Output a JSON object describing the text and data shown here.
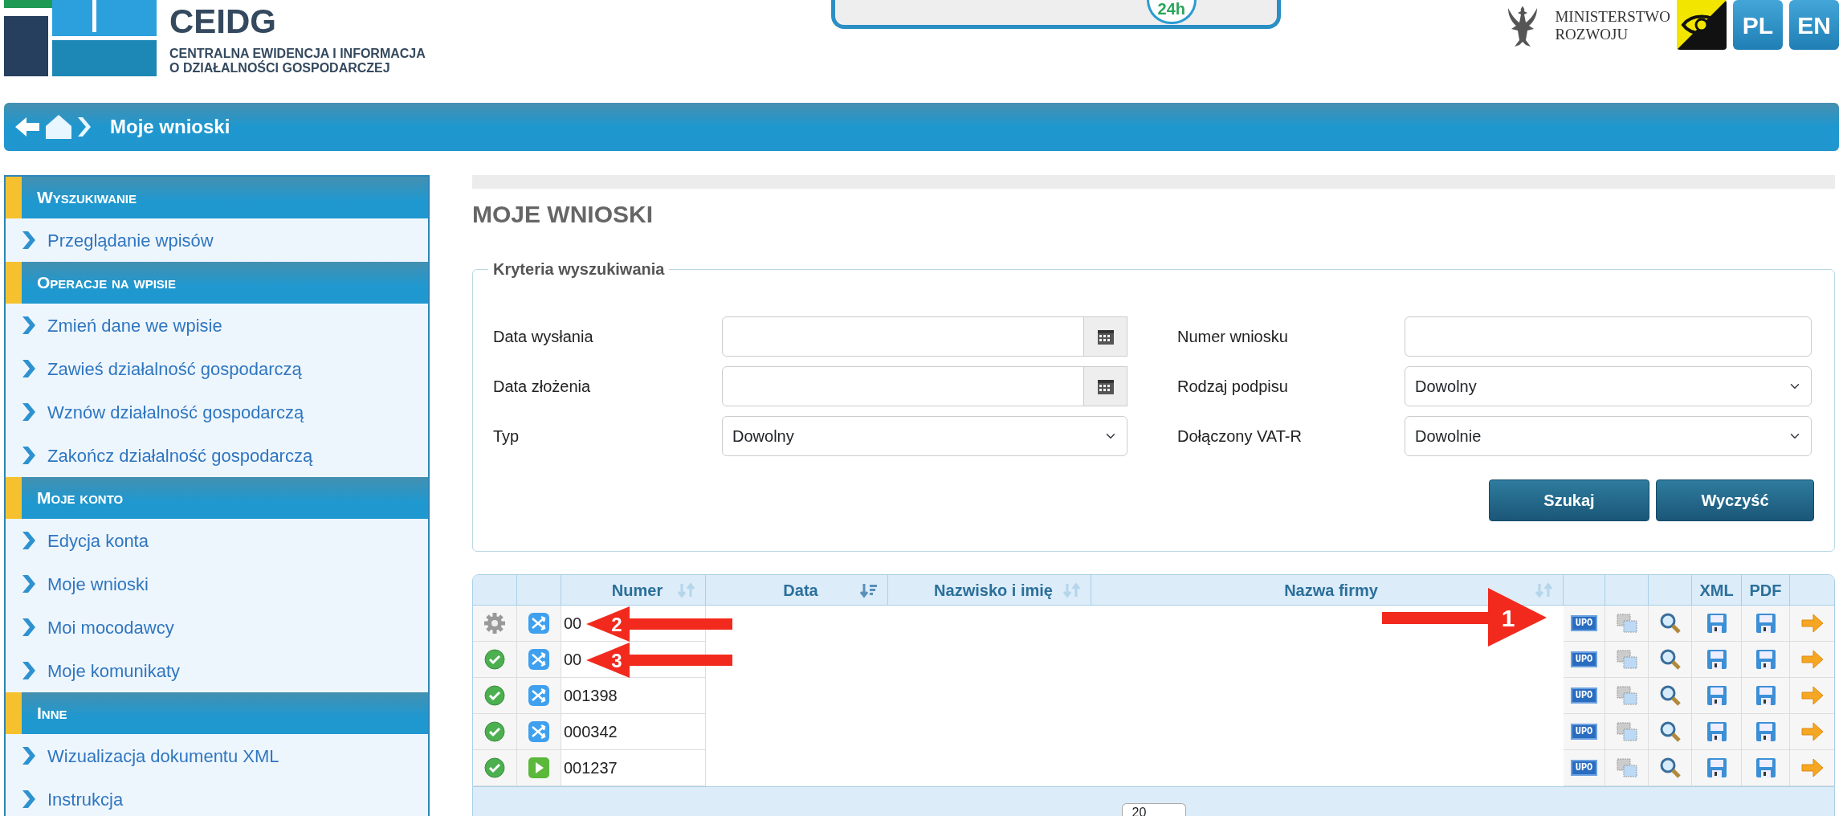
{
  "header": {
    "title": "CEIDG",
    "subtitle_lines": [
      "CENTRALNA EWIDENCJA I INFORMACJA",
      "O DZIAŁALNOŚCI GOSPODARCZEJ"
    ],
    "banner_badge": "24h",
    "ministry_lines": [
      "MINISTERSTWO",
      "ROZWOJU"
    ],
    "languages": [
      "PL",
      "EN"
    ]
  },
  "breadcrumb": {
    "title": "Moje wnioski"
  },
  "sidebar": {
    "sections": [
      {
        "title": "Wyszukiwanie",
        "items": [
          "Przeglądanie wpisów"
        ]
      },
      {
        "title": "Operacje na wpisie",
        "items": [
          "Zmień dane we wpisie",
          "Zawieś działalność gospodarczą",
          "Wznów działalność gospodarczą",
          "Zakończ działalność gospodarczą"
        ]
      },
      {
        "title": "Moje konto",
        "items": [
          "Edycja konta",
          "Moje wnioski",
          "Moi mocodawcy",
          "Moje komunikaty"
        ]
      },
      {
        "title": "Inne",
        "items": [
          "Wizualizacja dokumentu XML",
          "Instrukcja"
        ]
      }
    ]
  },
  "page_title": "MOJE WNIOSKI",
  "search": {
    "legend": "Kryteria wyszukiwania",
    "fields": [
      {
        "kind": "date",
        "label": "Data wysłania"
      },
      {
        "kind": "text",
        "label": "Numer wniosku"
      },
      {
        "kind": "date",
        "label": "Data złożenia"
      },
      {
        "kind": "select",
        "label": "Rodzaj podpisu",
        "value": "Dowolny"
      },
      {
        "kind": "select",
        "label": "Typ",
        "value": "Dowolny"
      },
      {
        "kind": "select",
        "label": "Dołączony VAT-R",
        "value": "Dowolnie"
      }
    ],
    "buttons": [
      "Szukaj",
      "Wyczyść"
    ]
  },
  "table": {
    "columns": [
      {
        "kind": "blank"
      },
      {
        "kind": "blank"
      },
      {
        "kind": "sortable",
        "label": "Numer",
        "sorted_desc": false
      },
      {
        "kind": "sortable",
        "label": "Data",
        "sorted_desc": true
      },
      {
        "kind": "sortable",
        "label": "Nazwisko i imię",
        "sorted_desc": false
      },
      {
        "kind": "sortable",
        "label": "Nazwa firmy",
        "sorted_desc": false
      },
      {
        "kind": "blank"
      },
      {
        "kind": "blank"
      },
      {
        "kind": "blank"
      },
      {
        "kind": "label",
        "label": "XML"
      },
      {
        "kind": "label",
        "label": "PDF"
      },
      {
        "kind": "blank"
      }
    ],
    "rows": [
      {
        "processing": true,
        "kind": "transfer",
        "number": "00",
        "upo": "UPO"
      },
      {
        "processing": false,
        "kind": "transfer",
        "number": "00",
        "upo": "UPO"
      },
      {
        "processing": false,
        "kind": "transfer",
        "number": "001398",
        "upo": "UPO"
      },
      {
        "processing": false,
        "kind": "transfer",
        "number": "000342",
        "upo": "UPO"
      },
      {
        "processing": false,
        "kind": "play",
        "number": "001237",
        "upo": "UPO"
      }
    ]
  },
  "pager": {
    "page_size": "20"
  },
  "annotations": [
    {
      "label": "1",
      "points_right": true
    },
    {
      "label": "2",
      "points_right": false
    },
    {
      "label": "3",
      "points_right": false
    }
  ]
}
